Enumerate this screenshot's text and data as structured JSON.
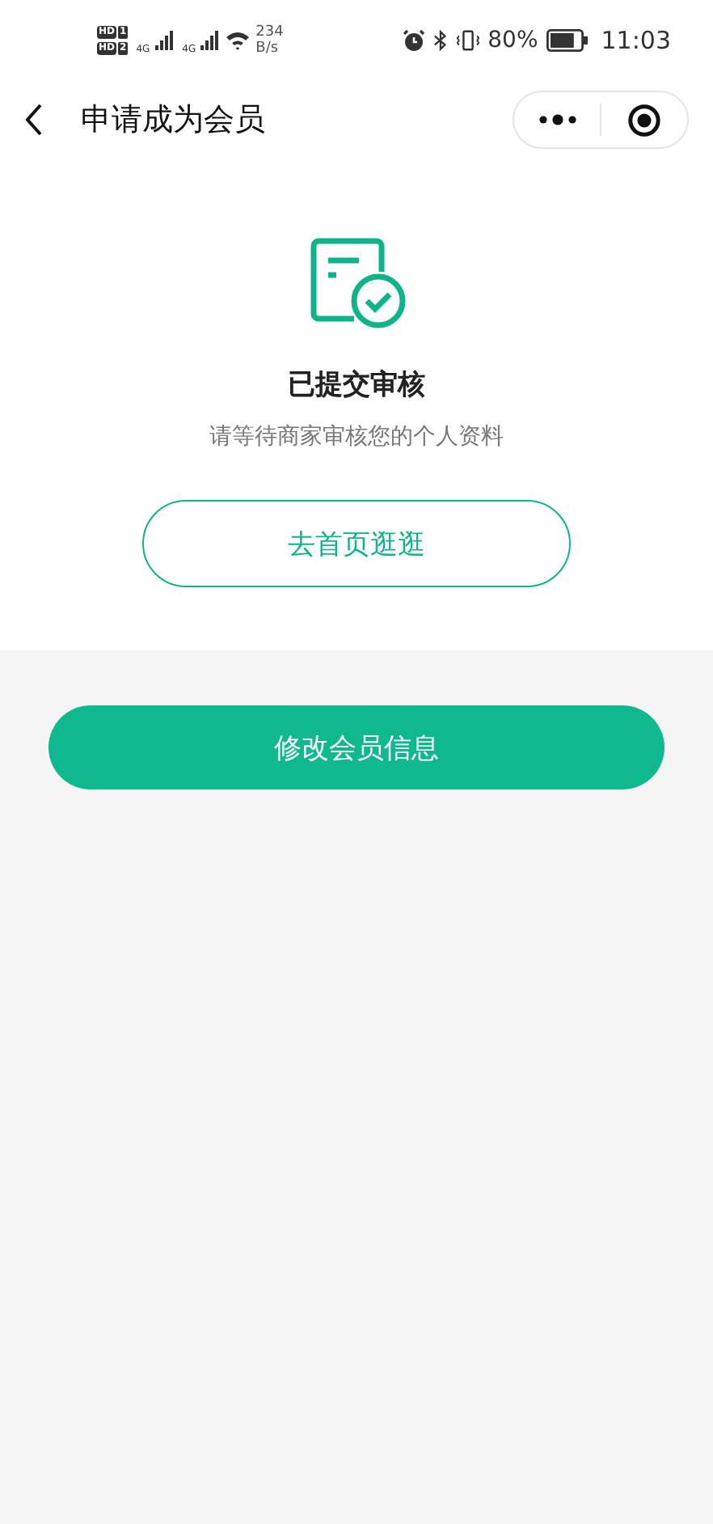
{
  "status_bar": {
    "sims": [
      {
        "badge": "HD",
        "slot": "1",
        "network": "4G"
      },
      {
        "badge": "HD",
        "slot": "2",
        "network": "4G"
      }
    ],
    "speed_value": "234",
    "speed_unit": "B/s",
    "battery_percent": "80%",
    "time": "11:03"
  },
  "nav_bar": {
    "title": "申请成为会员"
  },
  "result": {
    "title": "已提交审核",
    "message": "请等待商家审核您的个人资料",
    "link_button": "去首页逛逛"
  },
  "primary_button": "修改会员信息"
}
